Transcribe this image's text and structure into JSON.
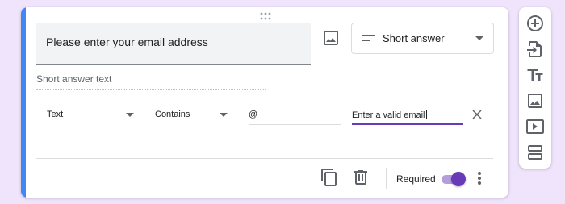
{
  "question": {
    "title": "Please enter your email address",
    "type_label": "Short answer",
    "answer_placeholder": "Short answer text"
  },
  "validation": {
    "type": "Text",
    "condition": "Contains",
    "pattern": "@",
    "error_text": "Enter a valid email"
  },
  "footer": {
    "required_label": "Required",
    "required_on": true
  },
  "icons": {
    "drag": "drag-handle-icon",
    "image": "image-icon",
    "short_answer": "short-text-icon",
    "dropdown": "arrow-drop-down-icon",
    "close": "close-icon",
    "duplicate": "content-copy-icon",
    "delete": "trash-icon",
    "more": "more-vert-icon",
    "add": "add-circle-icon",
    "import": "import-question-icon",
    "title": "title-text-icon",
    "add_image": "image-icon",
    "video": "video-icon",
    "section": "section-icon"
  },
  "colors": {
    "accent": "#4285f4",
    "purple": "#673ab7",
    "background": "#efe4fb"
  }
}
